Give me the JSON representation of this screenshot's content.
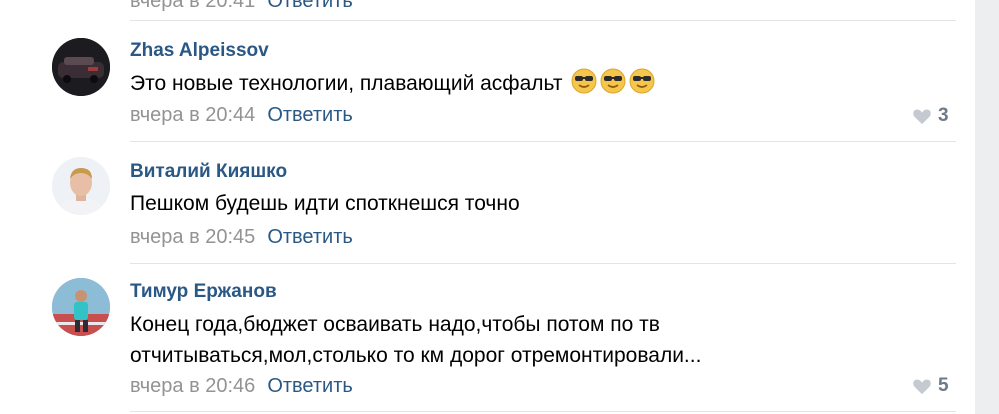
{
  "prev_comment": {
    "time": "вчера в 20:41",
    "reply_label": "Ответить"
  },
  "comments": [
    {
      "author": "Zhas Alpeissov",
      "text": "Это новые технологии, плавающий асфальт",
      "emoji": [
        "smiling-face-with-sunglasses",
        "smiling-face-with-sunglasses",
        "smiling-face-with-sunglasses"
      ],
      "time": "вчера в 20:44",
      "reply_label": "Ответить",
      "likes": "3"
    },
    {
      "author": "Виталий Кияшко",
      "text": "Пешком будешь идти споткнешся точно",
      "time": "вчера в 20:45",
      "reply_label": "Ответить"
    },
    {
      "author": "Тимур Ержанов",
      "text_lines": [
        "Конец года,бюджет осваивать надо,чтобы потом по тв",
        "отчитываться,мол,столько то км дорог отремонтировали..."
      ],
      "time": "вчера в 20:46",
      "reply_label": "Ответить",
      "likes": "5"
    }
  ],
  "colors": {
    "link": "#2a5885",
    "meta": "#939393",
    "like_icon": "#c5c9d0"
  }
}
